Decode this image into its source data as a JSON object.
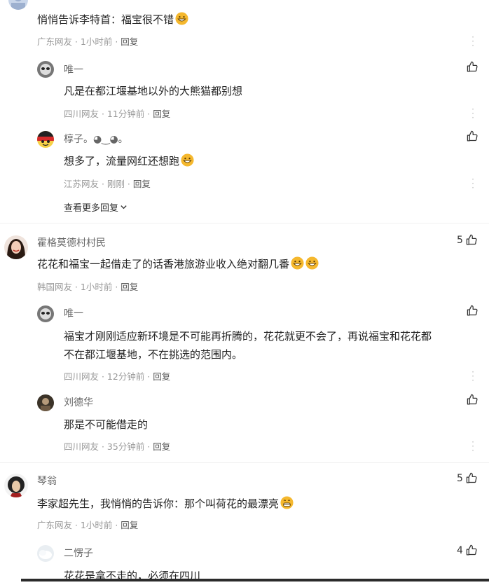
{
  "comments": [
    {
      "id": "c1",
      "text": "悄悄告诉李特首：福宝很不错",
      "meta": "广东网友 · 1小时前 · ",
      "reply_label": "回复",
      "replies": [
        {
          "name": "唯一",
          "text": "凡是在都江堰基地以外的大熊猫都别想",
          "meta": "四川网友 · 11分钟前 · ",
          "reply_label": "回复"
        },
        {
          "name": "椁子。◕‿◕。",
          "text": "想多了，流量网红还想跑",
          "meta": "江苏网友 · 刚刚 · ",
          "reply_label": "回复"
        }
      ],
      "more_replies": "查看更多回复"
    },
    {
      "id": "c2",
      "name": "霍格莫德村村民",
      "likes": "5",
      "text": "花花和福宝一起借走了的话香港旅游业收入绝对翻几番",
      "meta": "韩国网友 · 1小时前 · ",
      "reply_label": "回复",
      "replies": [
        {
          "name": "唯一",
          "text_line1": "福宝才刚刚适应新环境是不可能再折腾的，花花就更不会了，再说福宝和花花都",
          "text_line2": "不在都江堰基地，不在挑选的范围内。",
          "meta": "四川网友 · 12分钟前 · ",
          "reply_label": "回复"
        },
        {
          "name": "刘德华",
          "text": "那是不可能借走的",
          "meta": "四川网友 · 35分钟前 · ",
          "reply_label": "回复"
        }
      ]
    },
    {
      "id": "c3",
      "name": "琴翁",
      "likes": "5",
      "text": "李家超先生，我悄悄的告诉你：那个叫荷花的最漂亮",
      "meta": "广东网友 · 1小时前 · ",
      "reply_label": "回复",
      "replies": [
        {
          "name": "二愣子",
          "likes": "4",
          "text": "花花是拿不走的，必须在四川"
        }
      ]
    }
  ],
  "icons": {
    "like": "thumbs-up-icon",
    "more": "vertical-dots-icon",
    "chevron": "chevron-down-icon",
    "emoji_grin": "grinning-face-icon",
    "emoji_teeth": "grimacing-face-icon"
  },
  "colors": {
    "text": "#222222",
    "meta": "#999999",
    "emoji": "#f5b82e"
  }
}
